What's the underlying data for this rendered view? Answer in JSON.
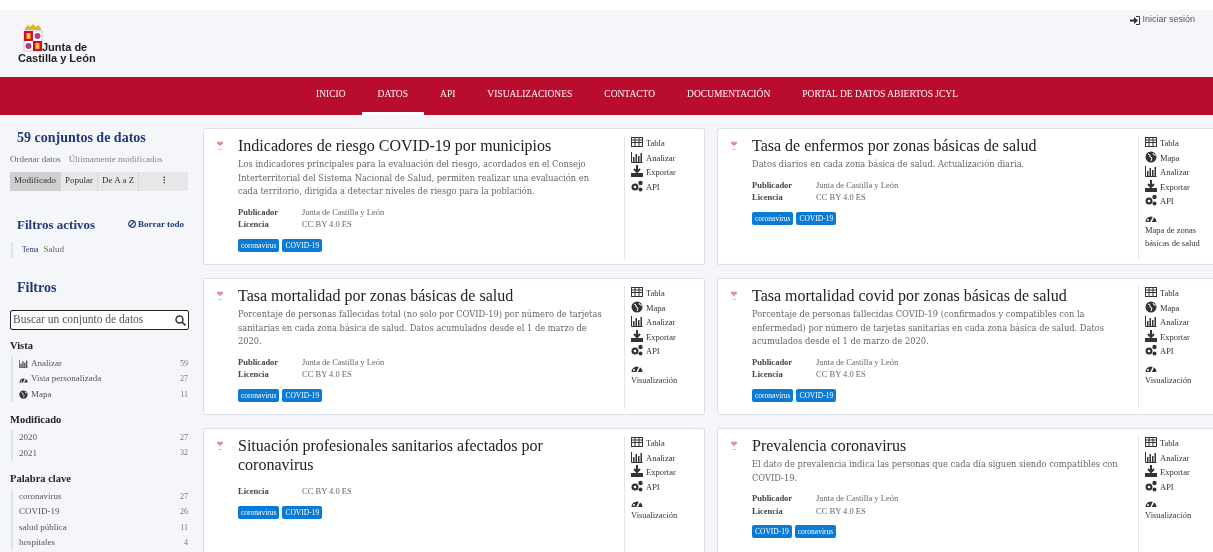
{
  "header": {
    "logo_text": [
      "Junta de",
      "Castilla y León"
    ],
    "login": "Iniciar sesión"
  },
  "nav": [
    {
      "label": "INICIO",
      "selected": false
    },
    {
      "label": "DATOS",
      "selected": true
    },
    {
      "label": "API",
      "selected": false
    },
    {
      "label": "VISUALIZACIONES",
      "selected": false
    },
    {
      "label": "CONTACTO",
      "selected": false
    },
    {
      "label": "DOCUMENTACIÓN",
      "selected": false
    },
    {
      "label": "PORTAL DE DATOS ABIERTOS JCYL",
      "selected": false
    }
  ],
  "sidebar": {
    "count_title": "59 conjuntos de datos",
    "sort_label": "Ordenar datos",
    "sort_value": "Últimamente modificados",
    "sort_buttons": [
      {
        "label": "Modificado",
        "selected": true
      },
      {
        "label": "Popular",
        "selected": false
      },
      {
        "label": "De A a Z",
        "selected": false
      },
      {
        "label": "⁝",
        "selected": false
      }
    ],
    "active_filters_title": "Filtros activos",
    "clear_all": "Borrar todo",
    "active_filters": [
      {
        "key": "Tema",
        "value": "Salud"
      }
    ],
    "filters_title": "Filtros",
    "search": {
      "placeholder": "Buscar un conjunto de datos"
    },
    "facets": [
      {
        "title": "Vista",
        "items": [
          {
            "label": "Analizar",
            "count": "59",
            "kind": "analyze"
          },
          {
            "label": "Vista personalizada",
            "count": "27",
            "kind": "viz"
          },
          {
            "label": "Mapa",
            "count": "11",
            "kind": "map"
          }
        ]
      },
      {
        "title": "Modificado",
        "items": [
          {
            "label": "2020",
            "count": "27"
          },
          {
            "label": "2021",
            "count": "32"
          }
        ]
      },
      {
        "title": "Palabra clave",
        "items": [
          {
            "label": "coronavirus",
            "count": "27"
          },
          {
            "label": "COVID-19",
            "count": "26"
          },
          {
            "label": "salud pública",
            "count": "11"
          },
          {
            "label": "hospitales",
            "count": "4"
          }
        ]
      }
    ]
  },
  "datasets": [
    {
      "title": "Indicadores de riesgo COVID-19 por municipios",
      "description": "Los indicadores principales para la evaluación del riesgo, acordados en el Consejo Interterritorial del Sistema Nacional de Salud, permiten realizar una evaluación en cada territorio, dirigida a detectar niveles de riesgo para la población.",
      "meta": [
        {
          "key": "Publicador",
          "value": "Junta de Castilla y León"
        },
        {
          "key": "Licencia",
          "value": "CC BY 4.0 ES"
        }
      ],
      "tags": [
        "coronavirus",
        "COVID-19"
      ],
      "actions": [
        {
          "kind": "table",
          "label": "Tabla"
        },
        {
          "kind": "analyze",
          "label": "Analizar"
        },
        {
          "kind": "export",
          "label": "Exportar"
        },
        {
          "kind": "api",
          "label": "API"
        }
      ]
    },
    {
      "title": "Tasa de enfermos por zonas básicas de salud",
      "description": "Datos diarios en cada zona básica de salud. Actualización diaria.",
      "meta": [
        {
          "key": "Publicador",
          "value": "Junta de Castilla y León"
        },
        {
          "key": "Licencia",
          "value": "CC BY 4.0 ES"
        }
      ],
      "tags": [
        "coronavirus",
        "COVID-19"
      ],
      "actions": [
        {
          "kind": "table",
          "label": "Tabla"
        },
        {
          "kind": "map",
          "label": "Mapa"
        },
        {
          "kind": "analyze",
          "label": "Analizar"
        },
        {
          "kind": "export",
          "label": "Exportar"
        },
        {
          "kind": "api",
          "label": "API"
        },
        {
          "kind": "viz",
          "label": "Mapa de zonas básicas de salud"
        }
      ]
    },
    {
      "title": "Tasa mortalidad por zonas básicas de salud",
      "description": "Porcentaje de personas fallecidas total (no solo por COVID-19) por número de tarjetas sanitarias en cada zona básica de salud. Datos acumulados desde el 1 de marzo de 2020.",
      "meta": [
        {
          "key": "Publicador",
          "value": "Junta de Castilla y León"
        },
        {
          "key": "Licencia",
          "value": "CC BY 4.0 ES"
        }
      ],
      "tags": [
        "coronavirus",
        "COVID-19"
      ],
      "actions": [
        {
          "kind": "table",
          "label": "Tabla"
        },
        {
          "kind": "map",
          "label": "Mapa"
        },
        {
          "kind": "analyze",
          "label": "Analizar"
        },
        {
          "kind": "export",
          "label": "Exportar"
        },
        {
          "kind": "api",
          "label": "API"
        },
        {
          "kind": "viz",
          "label": "Visualización"
        }
      ]
    },
    {
      "title": "Tasa mortalidad covid por zonas básicas de salud",
      "description": "Porcentaje de personas fallecidas COVID-19 (confirmados y compatibles con la enfermedad) por número de tarjetas sanitarias en cada zona básica de salud. Datos acumulados desde el 1 de marzo de 2020.",
      "meta": [
        {
          "key": "Publicador",
          "value": "Junta de Castilla y León"
        },
        {
          "key": "Licencia",
          "value": "CC BY 4.0 ES"
        }
      ],
      "tags": [
        "coronavirus",
        "COVID-19"
      ],
      "actions": [
        {
          "kind": "table",
          "label": "Tabla"
        },
        {
          "kind": "map",
          "label": "Mapa"
        },
        {
          "kind": "analyze",
          "label": "Analizar"
        },
        {
          "kind": "export",
          "label": "Exportar"
        },
        {
          "kind": "api",
          "label": "API"
        },
        {
          "kind": "viz",
          "label": "Visualización"
        }
      ]
    },
    {
      "title": "Situación profesionales sanitarios afectados por coronavirus",
      "meta": [
        {
          "key": "Licencia",
          "value": "CC BY 4.0 ES"
        }
      ],
      "tags": [
        "coronavirus",
        "COVID-19"
      ],
      "actions": [
        {
          "kind": "table",
          "label": "Tabla"
        },
        {
          "kind": "analyze",
          "label": "Analizar"
        },
        {
          "kind": "export",
          "label": "Exportar"
        },
        {
          "kind": "api",
          "label": "API"
        },
        {
          "kind": "viz",
          "label": "Visualización"
        }
      ]
    },
    {
      "title": "Prevalencia coronavirus",
      "description": "El dato de prevalencia indica las personas que cada día siguen siendo compatibles con COVID-19.",
      "meta": [
        {
          "key": "Publicador",
          "value": "Junta de Castilla y León"
        },
        {
          "key": "Licencia",
          "value": "CC BY 4.0 ES"
        }
      ],
      "tags": [
        "COVID-19",
        "coronavirus"
      ],
      "actions": [
        {
          "kind": "table",
          "label": "Tabla"
        },
        {
          "kind": "analyze",
          "label": "Analizar"
        },
        {
          "kind": "export",
          "label": "Exportar"
        },
        {
          "kind": "api",
          "label": "API"
        },
        {
          "kind": "viz",
          "label": "Visualización"
        }
      ]
    }
  ]
}
